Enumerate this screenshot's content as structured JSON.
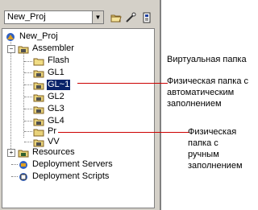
{
  "project_combo": {
    "value": "New_Proj"
  },
  "tree": {
    "root": "New_Proj",
    "assembler": "Assembler",
    "items": [
      "Flash",
      "GL1",
      "GL~1",
      "GL2",
      "GL3",
      "GL4",
      "Pr",
      "VV"
    ],
    "resources": "Resources",
    "deployment_servers": "Deployment Servers",
    "deployment_scripts": "Deployment Scripts"
  },
  "annotations": {
    "virtual": "Виртуальная папка",
    "physical_auto_line1": "Физическая папка с",
    "physical_auto_line2": "автоматическим",
    "physical_auto_line3": "заполнением",
    "physical_manual_line1": "Физическая папка с",
    "physical_manual_line2": "ручным заполнением"
  },
  "colors": {
    "leader_line": "#cc0000",
    "selection": "#0a246a",
    "panel": "#d4d0c8"
  }
}
